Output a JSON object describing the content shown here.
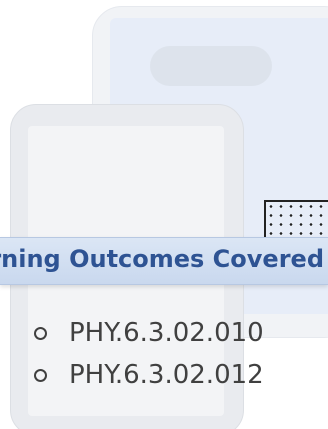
{
  "banner": {
    "title": "rning Outcomes Covered"
  },
  "outcomes": [
    "PHY.6.3.02.010",
    "PHY.6.3.02.012"
  ],
  "icons": {
    "watermark": "tablet-devices-icon",
    "bullet": "hollow-circle-bullet"
  },
  "colors": {
    "banner_text": "#2e5393",
    "banner_bg": "#d3e0f2",
    "body_text": "#404040"
  }
}
